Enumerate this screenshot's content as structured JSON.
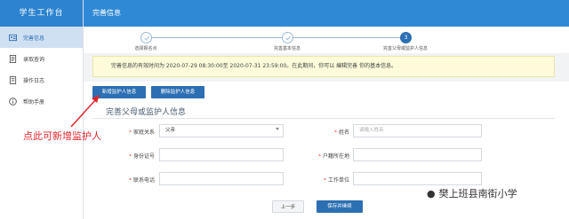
{
  "sidebar": {
    "title": "学生工作台",
    "items": [
      {
        "label": "完善信息",
        "icon": "id-card-icon",
        "active": true
      },
      {
        "label": "录取查询",
        "icon": "document-icon"
      },
      {
        "label": "操作日志",
        "icon": "log-icon"
      },
      {
        "label": "帮助手册",
        "icon": "info-icon"
      }
    ]
  },
  "header": {
    "title": "完善信息"
  },
  "steps": [
    {
      "label": "选择报名点",
      "state": "done"
    },
    {
      "label": "完善基本信息",
      "state": "done"
    },
    {
      "label": "完善父母或监护人信息",
      "state": "current",
      "number": "3"
    }
  ],
  "notice": "完善信息的有效时间为 2020-07-29 08:30:00至 2020-07-31 23:59:00。在此期间，你可以 编辑完善 你的基本信息。",
  "buttons": {
    "add": "新增监护人信息",
    "delete": "删除监护人信息",
    "prev": "上一步",
    "save": "保存并继续"
  },
  "section_title": "完善父母或监护人信息",
  "form": {
    "relation_label": "家庭关系",
    "relation_value": "父亲",
    "name_label": "姓名",
    "name_placeholder": "请输入姓名",
    "id_label": "身份证号",
    "hukou_label": "户籍所在地",
    "phone_label": "联系电话",
    "work_label": "工作单位"
  },
  "annotation": "点此可新增监护人",
  "watermark": "樊上班县南街小学",
  "colors": {
    "primary": "#2c6fb3",
    "header": "#3089d4",
    "annotation": "#e0252b"
  }
}
